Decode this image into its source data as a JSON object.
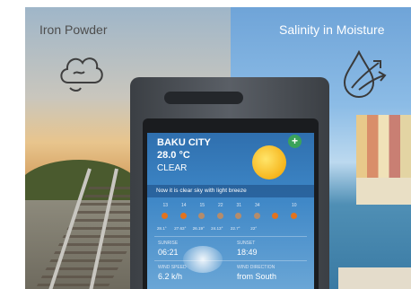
{
  "captions": {
    "left": "Iron Powder",
    "right": "Salinity in Moisture"
  },
  "icons": {
    "left": "cloud-outline-icon",
    "right": "water-drop-with-arrows-icon"
  },
  "weather": {
    "city": "BAKU CITY",
    "temperature": "28.0 °C",
    "condition": "CLEAR",
    "add_button": "+",
    "summary": "Now it is clear sky with light breeze",
    "hours": [
      "13",
      "14",
      "15",
      "22",
      "31",
      "34",
      "",
      "10"
    ],
    "temps": [
      "28.1°",
      "27.63°",
      "26.19°",
      "24.13°",
      "22.7°",
      "22°",
      "",
      ""
    ],
    "sunrise_label": "SUNRISE",
    "sunrise": "06:21",
    "sunset_label": "SUNSET",
    "sunset": "18:49",
    "wind_speed_label": "WIND SPEED",
    "wind_speed": "6.2 k/h",
    "wind_direction_label": "WIND DIRECTION",
    "wind_direction": "from South"
  },
  "colors": {
    "screen_top": "#2f6fae",
    "accent_plus": "#3aa35a",
    "sun": "#f6b51c"
  }
}
